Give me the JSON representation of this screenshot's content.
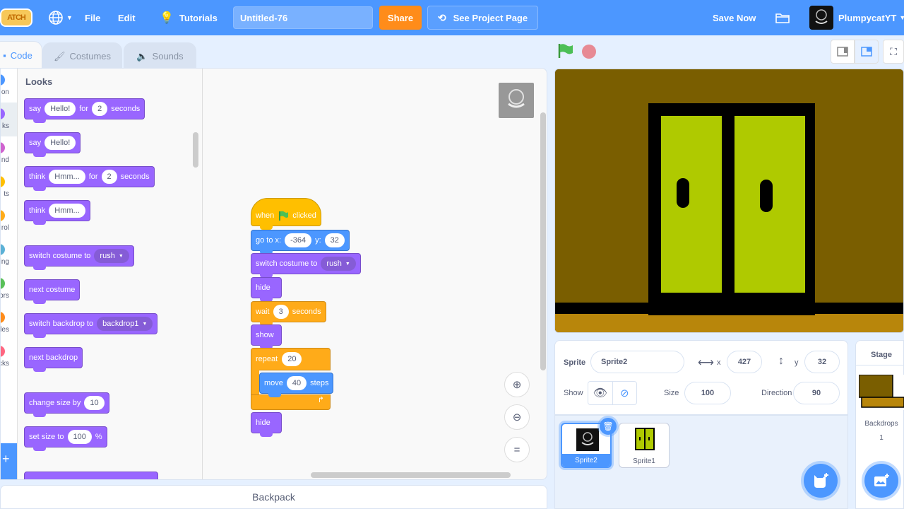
{
  "menubar": {
    "logo": "ATCH",
    "file": "File",
    "edit": "Edit",
    "tutorials": "Tutorials",
    "project_title": "Untitled-76",
    "share": "Share",
    "see_project_page": "See Project Page",
    "save_now": "Save Now",
    "username": "PlumpycatYT"
  },
  "tabs": [
    {
      "label": "Code",
      "active": true
    },
    {
      "label": "Costumes",
      "active": false
    },
    {
      "label": "Sounds",
      "active": false
    }
  ],
  "categories": [
    {
      "label": "on",
      "color": "#4c97ff"
    },
    {
      "label": "ks",
      "color": "#9966ff",
      "selected": true
    },
    {
      "label": "nd",
      "color": "#cf63cf"
    },
    {
      "label": "ts",
      "color": "#ffbf00"
    },
    {
      "label": "rol",
      "color": "#ffab19"
    },
    {
      "label": "ing",
      "color": "#5cb1d6"
    },
    {
      "label": "tors",
      "color": "#59c059"
    },
    {
      "label": "les",
      "color": "#ff8c1a"
    },
    {
      "label": "cks",
      "color": "#ff6680"
    }
  ],
  "palette": {
    "title": "Looks",
    "blocks": {
      "say_for": {
        "t1": "say",
        "v1": "Hello!",
        "t2": "for",
        "v2": "2",
        "t3": "seconds"
      },
      "say": {
        "t1": "say",
        "v1": "Hello!"
      },
      "think_for": {
        "t1": "think",
        "v1": "Hmm...",
        "t2": "for",
        "v2": "2",
        "t3": "seconds"
      },
      "think": {
        "t1": "think",
        "v1": "Hmm..."
      },
      "switch_costume": {
        "t1": "switch costume to",
        "v1": "rush"
      },
      "next_costume": {
        "t1": "next costume"
      },
      "switch_backdrop": {
        "t1": "switch backdrop to",
        "v1": "backdrop1"
      },
      "next_backdrop": {
        "t1": "next backdrop"
      },
      "change_size": {
        "t1": "change size by",
        "v1": "10"
      },
      "set_size": {
        "t1": "set size to",
        "v1": "100",
        "t2": "%"
      }
    }
  },
  "script": {
    "when_flag": {
      "t1": "when",
      "t2": "clicked"
    },
    "goto": {
      "t1": "go to x:",
      "x": "-364",
      "t2": "y:",
      "y": "32"
    },
    "switch_costume": {
      "t1": "switch costume to",
      "v1": "rush"
    },
    "hide1": "hide",
    "wait": {
      "t1": "wait",
      "v1": "3",
      "t2": "seconds"
    },
    "show": "show",
    "repeat": {
      "t1": "repeat",
      "v1": "20"
    },
    "move": {
      "t1": "move",
      "v1": "40",
      "t2": "steps"
    },
    "hide2": "hide"
  },
  "backpack": "Backpack",
  "sprite_info": {
    "sprite_label": "Sprite",
    "sprite_name": "Sprite2",
    "x_label": "x",
    "x": "427",
    "y_label": "y",
    "y": "32",
    "show_label": "Show",
    "size_label": "Size",
    "size": "100",
    "direction_label": "Direction",
    "direction": "90"
  },
  "sprites": [
    {
      "name": "Sprite2",
      "selected": true
    },
    {
      "name": "Sprite1",
      "selected": false
    }
  ],
  "stage_pane": {
    "title": "Stage",
    "backdrops_label": "Backdrops",
    "backdrops_count": "1"
  },
  "colors": {
    "accent": "#4c97ff",
    "share": "#ff8c1a",
    "looks": "#9966ff",
    "motion": "#4c97ff",
    "events": "#ffbf00",
    "control": "#ffab19",
    "stage_wall": "#7a5e00",
    "stage_floor": "#b8860b",
    "door": "#afca00"
  }
}
